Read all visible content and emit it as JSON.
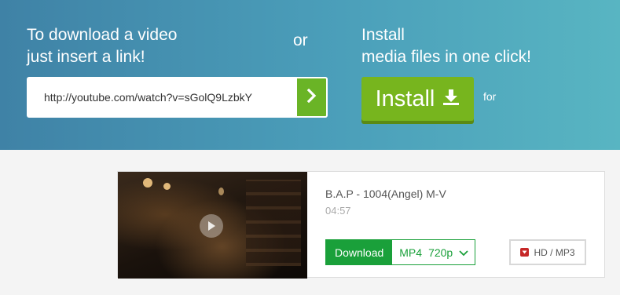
{
  "hero": {
    "left_line1": "To download a video",
    "left_line2": "just insert a link!",
    "or": "or",
    "right_line1": "Install",
    "right_line2": "media files in one click!",
    "install_label": "Install",
    "for_label": "for"
  },
  "search": {
    "url_value": "http://youtube.com/watch?v=sGolQ9LzbkY",
    "go_icon": "chevron-right-icon"
  },
  "result": {
    "title": "B.A.P - 1004(Angel) M-V",
    "duration": "04:57",
    "download_label": "Download",
    "format": "MP4",
    "quality": "720p",
    "hd_label": "HD / MP3"
  },
  "colors": {
    "accent_green": "#77b51e",
    "download_green": "#1aa03a",
    "hero_blue": "#4b9fba"
  }
}
